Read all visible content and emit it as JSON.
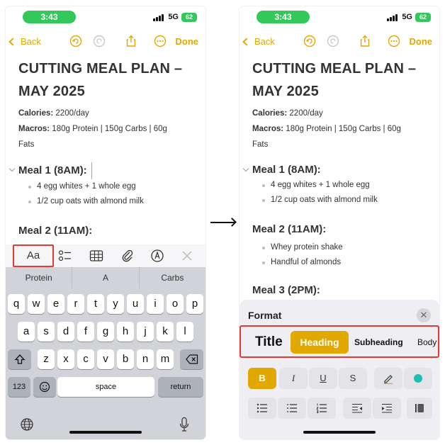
{
  "status": {
    "time": "3:43",
    "network": "5G",
    "battery": "62"
  },
  "nav": {
    "back_label": "Back",
    "done_label": "Done"
  },
  "note": {
    "title_line1": "CUTTING MEAL PLAN –",
    "title_line2": "MAY 2025",
    "calories_label": "Calories:",
    "calories_value": " 2200/day",
    "macros_label": "Macros:",
    "macros_value": " 180g Protein | 150g Carbs | 60g",
    "macros_value_line2": "Fats",
    "meal1": {
      "heading": "Meal 1 (8AM):",
      "items": [
        "4 egg whites + 1 whole egg",
        "1/2 cup oats with almond milk"
      ]
    },
    "meal2": {
      "heading": "Meal 2 (11AM):",
      "items": [
        "Whey protein shake",
        "Handful of almonds"
      ]
    },
    "meal3": {
      "heading": "Meal 3 (2PM):"
    }
  },
  "toolbar": {
    "aa_label": "Aa"
  },
  "keyboard": {
    "suggestions": [
      "Protein",
      "A",
      "Carbs"
    ],
    "row1": [
      "q",
      "w",
      "e",
      "r",
      "t",
      "y",
      "u",
      "i",
      "o",
      "p"
    ],
    "row2": [
      "a",
      "s",
      "d",
      "f",
      "g",
      "h",
      "j",
      "k",
      "l"
    ],
    "row3": [
      "z",
      "x",
      "c",
      "v",
      "b",
      "n",
      "m"
    ],
    "numbers_label": "123",
    "space_label": "space",
    "return_label": "return"
  },
  "format": {
    "title": "Format",
    "styles": {
      "title": "Title",
      "heading": "Heading",
      "subheading": "Subheading",
      "body": "Body"
    },
    "bold": "B",
    "italic": "I",
    "underline": "U",
    "strike": "S",
    "accent_color": "#e0a800",
    "dot_color": "#1ec0b4"
  }
}
